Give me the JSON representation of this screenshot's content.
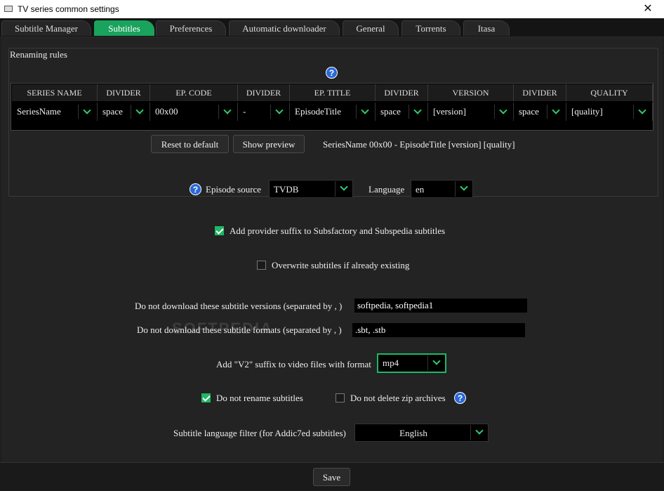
{
  "window": {
    "title": "TV series common settings",
    "close": "✕"
  },
  "tabs": [
    "Subtitle Manager",
    "Subtitles",
    "Preferences",
    "Automatic downloader",
    "General",
    "Torrents",
    "Itasa"
  ],
  "active_tab": "Subtitles",
  "renaming": {
    "label": "Renaming rules",
    "headers": [
      "SERIES NAME",
      "DIVIDER",
      "EP. CODE",
      "DIVIDER",
      "EP. TITLE",
      "DIVIDER",
      "VERSION",
      "DIVIDER",
      "QUALITY"
    ],
    "values": [
      "SeriesName",
      "space",
      "00x00",
      "-",
      "EpisodeTitle",
      "space",
      "[version]",
      "space",
      "[quality]"
    ],
    "reset_label": "Reset to default",
    "preview_label": "Show preview",
    "preview_text": "SeriesName 00x00 - EpisodeTitle [version] [quality]"
  },
  "episode_source": {
    "label": "Episode source",
    "value": "TVDB"
  },
  "language": {
    "label": "Language",
    "value": "en"
  },
  "provider_suffix": {
    "label": "Add provider suffix to Subsfactory and Subspedia subtitles",
    "checked": true
  },
  "overwrite": {
    "label": "Overwrite subtitles if already existing",
    "checked": false
  },
  "exclude_versions": {
    "label": "Do not download these subtitle versions (separated by , )",
    "value": "softpedia, softpedia1"
  },
  "exclude_formats": {
    "label": "Do not download these subtitle formats (separated by , )",
    "value": ".sbt, .stb"
  },
  "v2_suffix": {
    "label": "Add \"V2\" suffix to video files with format",
    "value": "mp4"
  },
  "no_rename": {
    "label": "Do not rename subtitles",
    "checked": true
  },
  "no_delete_zip": {
    "label": "Do not delete zip archives",
    "checked": false
  },
  "lang_filter": {
    "label": "Subtitle language filter (for Addic7ed subtitles)",
    "value": "English"
  },
  "save_label": "Save",
  "watermark": "SOFTPEDIA",
  "help_glyph": "?",
  "colors": {
    "accent": "#1aa35c",
    "help": "#2a68d8",
    "background": "#232323"
  }
}
